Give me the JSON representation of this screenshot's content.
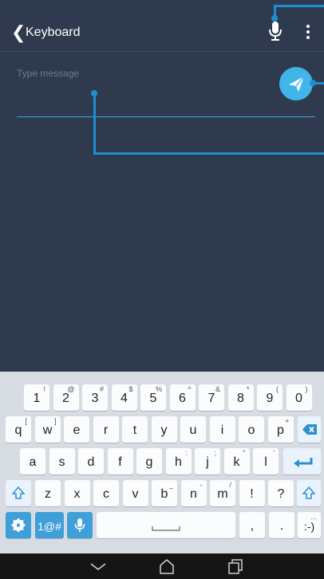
{
  "header": {
    "back_glyph": "❮",
    "title": "Keyboard"
  },
  "compose": {
    "placeholder": "Type message"
  },
  "keyboard": {
    "rows": [
      [
        {
          "label": "1",
          "sup": "!"
        },
        {
          "label": "2",
          "sup": "@"
        },
        {
          "label": "3",
          "sup": "#"
        },
        {
          "label": "4",
          "sup": "$"
        },
        {
          "label": "5",
          "sup": "%"
        },
        {
          "label": "6",
          "sup": "^"
        },
        {
          "label": "7",
          "sup": "&"
        },
        {
          "label": "8",
          "sup": "*"
        },
        {
          "label": "9",
          "sup": "("
        },
        {
          "label": "0",
          "sup": ")"
        }
      ],
      [
        {
          "label": "q",
          "sup": "["
        },
        {
          "label": "w",
          "sup": "]"
        },
        {
          "label": "e",
          "sup": ""
        },
        {
          "label": "r",
          "sup": ""
        },
        {
          "label": "t",
          "sup": ""
        },
        {
          "label": "y",
          "sup": ""
        },
        {
          "label": "u",
          "sup": ""
        },
        {
          "label": "i",
          "sup": ""
        },
        {
          "label": "o",
          "sup": ""
        },
        {
          "label": "p",
          "sup": "+"
        }
      ],
      [
        {
          "label": "a",
          "sup": ""
        },
        {
          "label": "s",
          "sup": ""
        },
        {
          "label": "d",
          "sup": ""
        },
        {
          "label": "f",
          "sup": ""
        },
        {
          "label": "g",
          "sup": ""
        },
        {
          "label": "h",
          "sup": ":"
        },
        {
          "label": "j",
          "sup": ";"
        },
        {
          "label": "k",
          "sup": "\""
        },
        {
          "label": "l",
          "sup": "'"
        }
      ],
      [
        {
          "label": "z",
          "sup": ""
        },
        {
          "label": "x",
          "sup": ""
        },
        {
          "label": "c",
          "sup": ""
        },
        {
          "label": "v",
          "sup": ""
        },
        {
          "label": "b",
          "sup": "_"
        },
        {
          "label": "n",
          "sup": "-"
        },
        {
          "label": "m",
          "sup": "/"
        },
        {
          "label": "!",
          "sup": ""
        },
        {
          "label": "?",
          "sup": ""
        }
      ]
    ],
    "symbols_label": "1@#",
    "comma": ",",
    "period": ".",
    "emoticon": ":-)",
    "emoticon_sup": "..."
  },
  "colors": {
    "app_bg": "#2f3a4f",
    "accent": "#3fb5e8",
    "annotation": "#1b8fd0",
    "keyboard_bg": "#d7dce3",
    "nav_bg": "#151515"
  }
}
